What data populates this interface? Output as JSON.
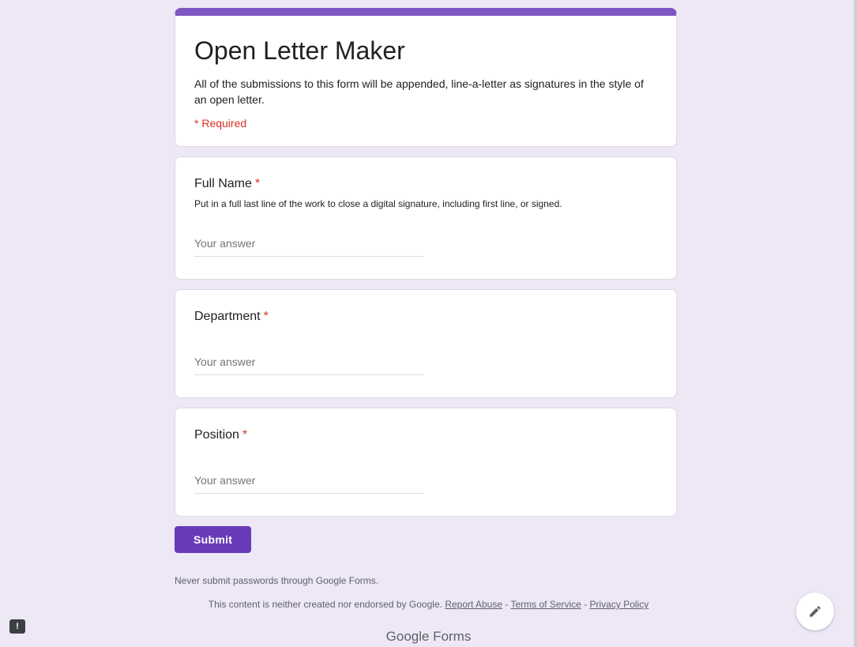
{
  "form": {
    "title": "Open Letter Maker",
    "description": "All of the submissions to this form will be appended, line-a-letter as signatures in the style of an open letter.",
    "required_note": "* Required",
    "accent_color": "#7e57c2",
    "background_color": "#ede7f6"
  },
  "questions": [
    {
      "label": "Full Name",
      "required_mark": "*",
      "help": "Put in a full last line of the work to close a digital signature, including first line, or signed.",
      "answer_placeholder": "Your answer"
    },
    {
      "label": "Department",
      "required_mark": "*",
      "help": "",
      "answer_placeholder": "Your answer"
    },
    {
      "label": "Position",
      "required_mark": "*",
      "help": "",
      "answer_placeholder": "Your answer"
    }
  ],
  "submit": {
    "label": "Submit",
    "color": "#673ab7"
  },
  "never_submit_note": "Never submit passwords through Google Forms.",
  "footer": {
    "text": "This content is neither created nor endorsed by Google.",
    "links": [
      "Report Abuse",
      "Terms of Service",
      "Privacy Policy"
    ],
    "separator": " - ",
    "brand": "Google Forms"
  },
  "icons": {
    "fab": "edit-pencil-icon",
    "report": "report-problem-icon"
  }
}
